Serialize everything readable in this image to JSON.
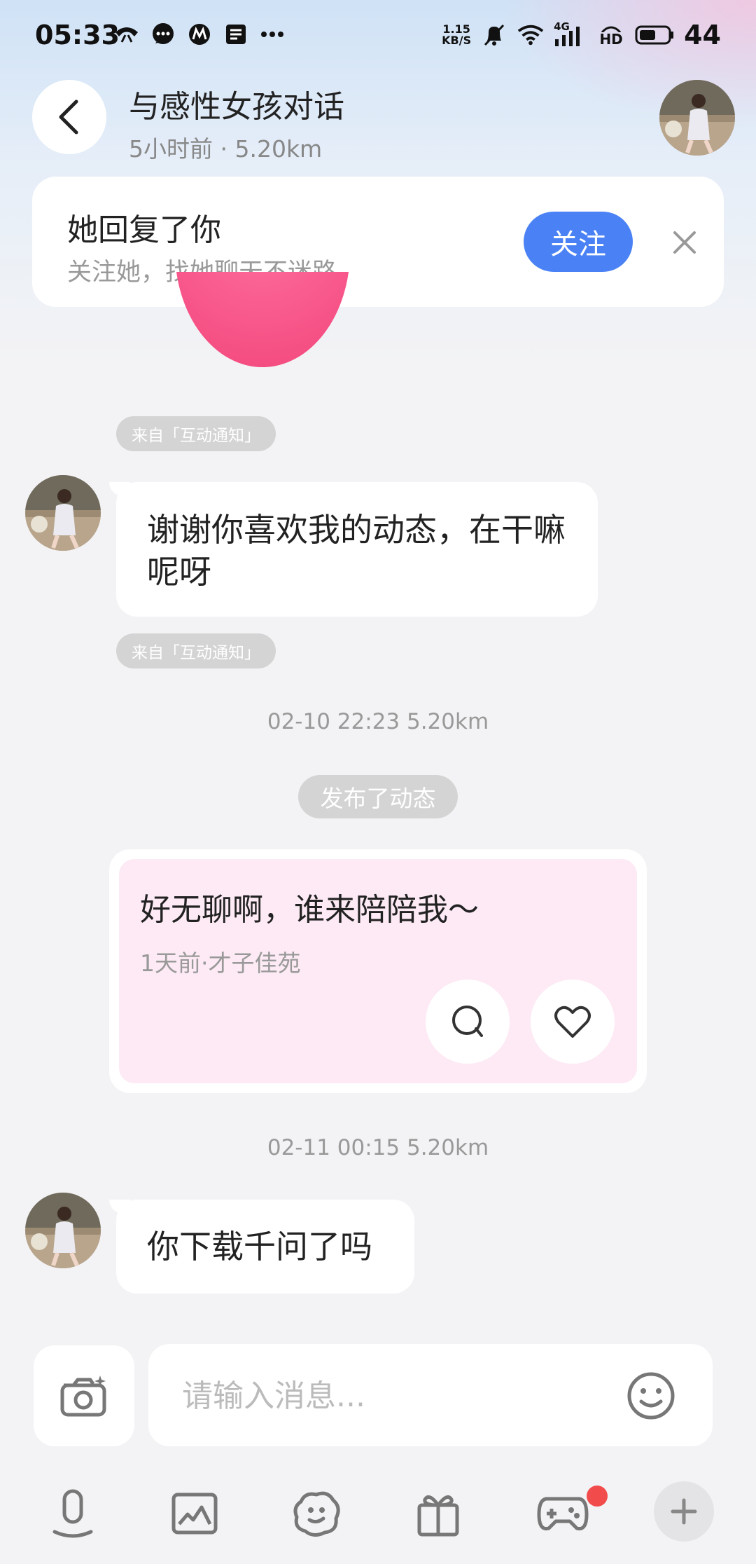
{
  "status_bar": {
    "time": "05:33",
    "net_speed_value": "1.15",
    "net_speed_unit": "KB/S",
    "network_type": "4G",
    "hd_label": "HD",
    "battery": "44",
    "left_icons": [
      "phone-icon",
      "chat-icon",
      "app-icon",
      "notes-icon",
      "more-dots-icon"
    ],
    "right_icons": [
      "mute-bell-icon",
      "wifi-icon",
      "signal-icon",
      "battery-icon"
    ]
  },
  "header": {
    "title": "与感性女孩对话",
    "subtitle": "5小时前 · 5.20km"
  },
  "notify": {
    "title": "她回复了你",
    "subtitle": "关注她，找她聊天不迷路",
    "follow_label": "关注"
  },
  "messages": {
    "source_tag_1": "来自「互动通知」",
    "msg1": "谢谢你喜欢我的动态，在干嘛呢呀",
    "source_tag_2": "来自「互动通知」",
    "timestamp1": "02-10 22:23  5.20km",
    "event_chip": "发布了动态",
    "post_text": "好无聊啊，谁来陪陪我～",
    "post_meta": "1天前·才子佳苑",
    "timestamp2": "02-11 00:15  5.20km",
    "msg2": "你下载千问了吗"
  },
  "input": {
    "placeholder": "请输入消息..."
  },
  "colors": {
    "accent": "#4a82f5",
    "badge": "#f24b4b",
    "post_bg": "#fdeaf4"
  }
}
